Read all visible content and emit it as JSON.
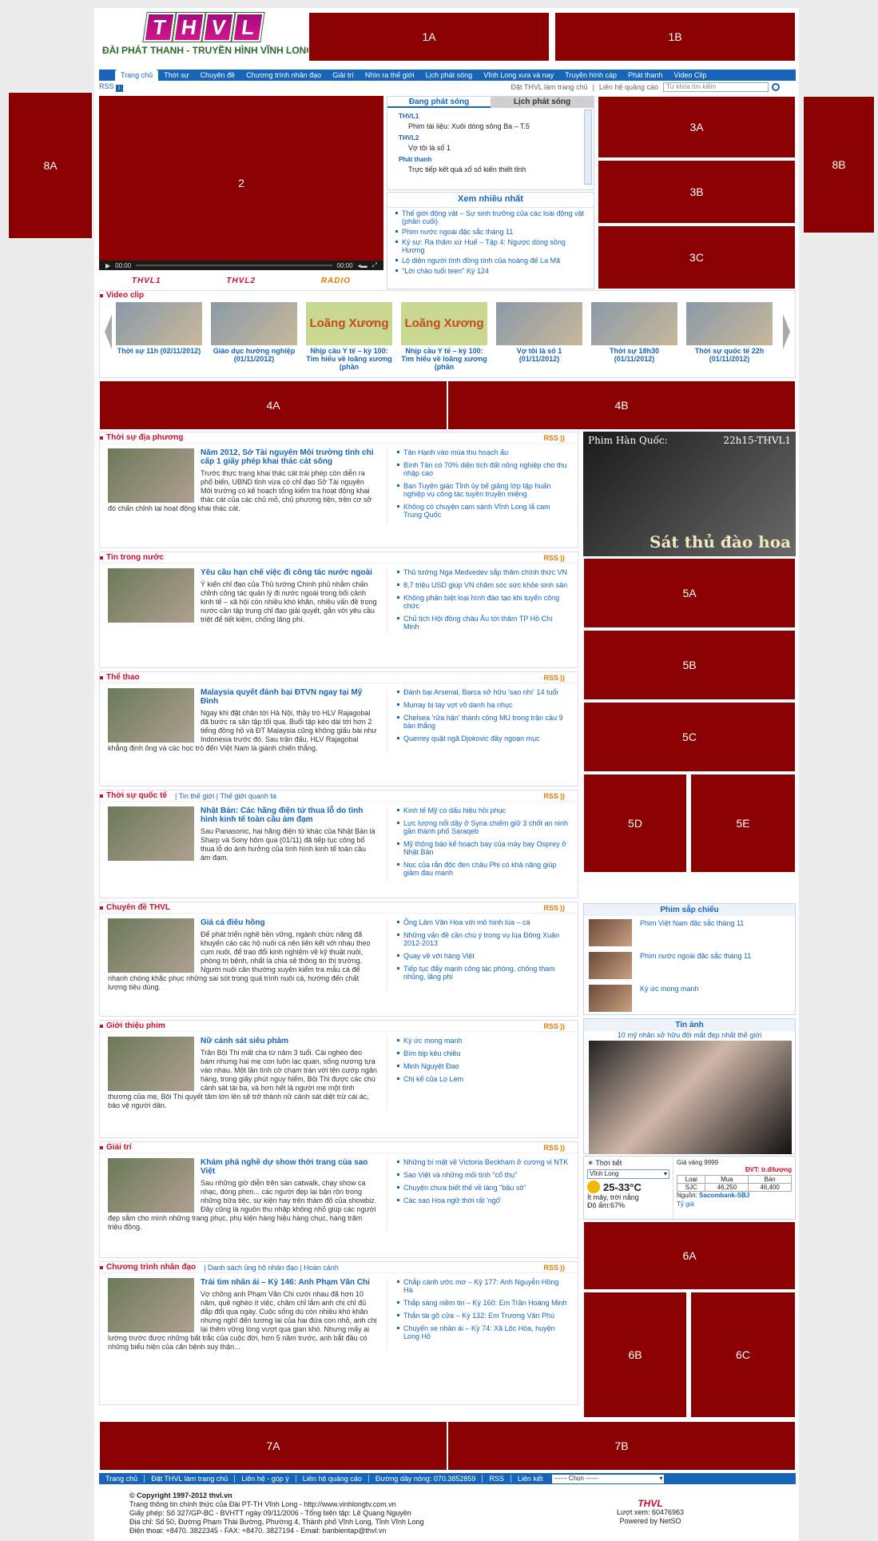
{
  "ads": {
    "a1A": "1A",
    "a1B": "1B",
    "a2": "2",
    "a3A": "3A",
    "a3B": "3B",
    "a3C": "3C",
    "a4A": "4A",
    "a4B": "4B",
    "a5A": "5A",
    "a5B": "5B",
    "a5C": "5C",
    "a5D": "5D",
    "a5E": "5E",
    "a6A": "6A",
    "a6B": "6B",
    "a6C": "6C",
    "a7A": "7A",
    "a7B": "7B",
    "a8A": "8A",
    "a8B": "8B"
  },
  "header": {
    "logo_letters": [
      "T",
      "H",
      "V",
      "L"
    ],
    "station_name": "ĐÀI PHÁT THANH - TRUYỀN HÌNH VĨNH LONG"
  },
  "nav": [
    "Trang chủ",
    "Thời sự",
    "Chuyên đề",
    "Chương trình nhân đạo",
    "Giải trí",
    "Nhìn ra thế giới",
    "Lịch phát sóng",
    "Vĩnh Long xưa và nay",
    "Truyền hình cáp",
    "Phát thanh",
    "Video Clip"
  ],
  "subbar": {
    "rss": "RSS",
    "link1": "Đặt THVL làm trang chủ",
    "link2": "Liên hệ quảng cáo",
    "search_placeholder": "Từ khóa tìm kiếm"
  },
  "player": {
    "time_left": "00:00",
    "time_right": "00:00"
  },
  "channels": [
    "THVL1",
    "THVL2",
    "RADIO"
  ],
  "schedule": {
    "tab_active": "Đang phát sóng",
    "tab_other": "Lịch phát sóng",
    "items": [
      {
        "channel": "THVL1",
        "program": "Phim tài liệu: Xuôi dòng sông Ba – T.5"
      },
      {
        "channel": "THVL2",
        "program": "Vợ tôi là số 1"
      },
      {
        "channel": "Phát thanh",
        "program": "Trực tiếp kết quả xổ số kiến thiết tỉnh"
      }
    ]
  },
  "most_viewed": {
    "title": "Xem nhiều nhất",
    "items": [
      "Thế giới động vật – Sự sinh trưởng của các loài động vật (phần cuối)",
      "Phim nước ngoài đặc sắc tháng 11",
      "Ký sự: Ra thăm xứ Huế – Tập 4: Ngược dòng sông Hương",
      "Lộ diện người tình đồng tính của hoàng đế La Mã",
      "\"Lời chào tuổi teen\" Kỳ 124"
    ]
  },
  "video": {
    "title": "Video clip",
    "items": [
      {
        "caption": "Thời sự 11h (02/11/2012)",
        "thumb": ""
      },
      {
        "caption": "Giáo dục hướng nghiệp (01/11/2012)",
        "thumb": ""
      },
      {
        "caption": "Nhịp cầu Y tế – kỳ 100: Tìm hiểu về loãng xương (phần",
        "thumb": "Loãng Xương"
      },
      {
        "caption": "Nhịp cầu Y tế – kỳ 100: Tìm hiểu về loãng xương (phần",
        "thumb": "Loãng Xương"
      },
      {
        "caption": "Vợ tôi là số 1 (01/11/2012)",
        "thumb": ""
      },
      {
        "caption": "Thời sự 18h30 (01/11/2012)",
        "thumb": ""
      },
      {
        "caption": "Thời sự quốc tế 22h (01/11/2012)",
        "thumb": ""
      }
    ]
  },
  "sections": [
    {
      "title": "Thời sự địa phương",
      "sub": "",
      "headline": "Năm 2012, Sở Tài nguyên Môi trường tỉnh chỉ cấp 1 giấy phép khai thác cát sông",
      "desc": "Trước thực trạng khai thác cát trái phép còn diễn ra phổ biến, UBND tỉnh vừa có chỉ đạo Sở Tài nguyên Môi trường có kế hoạch tổng kiểm tra hoạt động khai thác cát của các chủ mỏ, chủ phương tiện, trên cơ sở đó chấn chỉnh lại hoạt động khai thác cát.",
      "links": [
        "Tân Hạnh vào mùa thu hoạch ấu",
        "Bình Tân có 70% diện tích đất nông nghiệp cho thu nhập cao",
        "Ban Tuyên giáo Tỉnh ủy bế giảng lớp tập huấn nghiệp vụ công tác tuyên truyền miệng",
        "Không có chuyện cam sành Vĩnh Long lấ cam Trung Quốc"
      ]
    },
    {
      "title": "Tin trong nước",
      "sub": "",
      "headline": "Yêu cầu hạn chế việc đi công tác nước ngoài",
      "desc": "Ý kiến chỉ đạo của Thủ tướng Chính phủ nhằm chấn chỉnh công tác quản lý đi nước ngoài trong bối cảnh kinh tế – xã hội còn nhiều khó khăn, nhiều vấn đề trong nước cần tập trung chỉ đạo giải quyết, gắn với yêu cầu triệt để tiết kiệm, chống lãng phí.",
      "links": [
        "Thủ tướng Nga Medvedev sắp thăm chính thức VN",
        "8,7 triệu USD giúp VN chăm sóc sức khỏe sinh sản",
        "Không phân biệt loại hình đào tạo khi tuyển công chức",
        "Chủ tịch Hội đồng châu Âu tới thăm TP Hồ Chí Minh"
      ]
    },
    {
      "title": "Thể thao",
      "sub": "",
      "headline": "Malaysia quyết đánh bại ĐTVN ngay tại Mỹ Đình",
      "desc": "Ngay khi đặt chân tới Hà Nội, thầy trò HLV Rajagobal đã bước ra sân tập tối qua. Buổi tập kéo dài tới hơn 2 tiếng đồng hồ và ĐT Malaysia cũng không giấu bài như Indonesia trước đó. Sau trận đấu, HLV Rajagobal khẳng định ông và các học trò đến Việt Nam là giành chiến thắng.",
      "links": [
        "Đánh bại Arsenal, Barca sở hữu 'sao nhí' 14 tuổi",
        "Murray bị tay vợt vô danh hạ nhục",
        "Chelsea 'rửa hận' thành công MU trong trận cầu 9 bàn thắng",
        "Querrey quật ngã Djokovic đầy ngoạn mục"
      ]
    },
    {
      "title": "Thời sự quốc tế",
      "sub": "| Tin thế giới | Thế giới quanh ta",
      "headline": "Nhật Bản: Các hãng điện tử thua lỗ do tình hình kinh tế toàn cầu ảm đạm",
      "desc": "Sau Panasonic, hai hãng điện tử khác của Nhật Bản là Sharp và Sony hôm qua (01/11) đã tiếp tục công bố thua lỗ do ảnh hưởng của tình hình kinh tế toàn cầu ảm đạm.",
      "links": [
        "Kinh tế Mỹ có dấu hiệu hồi phục",
        "Lực lượng nổi dậy ở Syria chiếm giữ 3 chốt an ninh gần thành phố Saraqeb",
        "Mỹ thông báo kế hoạch bay của máy bay Osprey ở Nhật Bản",
        "Nọc của rắn độc đen châu Phi có khả năng giúp giảm đau mạnh"
      ]
    },
    {
      "title": "Chuyên đề THVL",
      "sub": "",
      "headline": "Giá cá điêu hồng",
      "desc": "Để phát triển nghề bền vững, ngành chức năng đã khuyến cáo các hộ nuôi cá nên liên kết với nhau theo cụm nuôi, để trao đổi kinh nghiệm về kỹ thuật nuôi, phòng trị bệnh, nhất là chia sẻ thông tin thị trường. Người nuôi cần thường xuyên kiểm tra mẫu cá để nhanh chóng khắc phục những sai sót trong quá trình nuôi cá, hướng đến chất lượng tiêu dùng.",
      "links": [
        "Ông Lâm Văn Hoa với mô hình lúa – cá",
        "Những vấn đề cần chú ý trong vụ lúa Đông Xuân 2012-2013",
        "Quay về với hàng Việt",
        "Tiếp tục đẩy mạnh công tác phòng, chống tham nhũng, lãng phí"
      ]
    },
    {
      "title": "Giới thiệu phim",
      "sub": "",
      "headline": "Nữ cảnh sát siêu phàm",
      "desc": "Trần Bội Thi mất cha từ năm 3 tuổi. Cái nghèo đeo bám nhưng hai mẹ con luôn lạc quan, sống nương tựa vào nhau. Một lần tình cờ chạm trán với tên cướp ngân hàng, trong giây phút nguy hiểm, Bội Thi được các chú cảnh sát tài ba, và hơn hết là người mẹ một tình thương của mẹ, Bội Thi quyết tâm lớn lên sẽ trở thành nữ cảnh sát diệt trừ cái ác, bảo vệ người dân.",
      "links": [
        "Ký ức mong manh",
        "Bím bịp kêu chiều",
        "Minh Nguyệt Đao",
        "Chị kế của Lọ Lem"
      ]
    },
    {
      "title": "Giải trí",
      "sub": "",
      "headline": "Khám phá nghề dự show thời trang của sao Việt",
      "desc": "Sau những giờ diễn trên sàn catwalk, chạy show ca nhạc, đóng phim... các người đẹp lại bận rộn trong những bữa tiệc, sự kiện hay trên thảm đỏ của showbiz. Đây cũng là nguồn thu nhập không nhỏ giúp các người đẹp sắm cho mình những trang phục, phụ kiện hàng hiệu hàng chục, hàng trăm triệu đồng.",
      "links": [
        "Những bí mật về Victoria Beckham ở cương vị NTK",
        "Sao Việt và những mối tình \"cổ thụ\"",
        "Chuyện chưa biết thế về làng \"bầu sô\"",
        "Các sao Hoa ngữ thời rất 'ngố'"
      ]
    },
    {
      "title": "Chương trình nhân đạo",
      "sub": "| Danh sách ủng hộ nhân đạo | Hoàn cảnh",
      "headline": "Trái tim nhân ái – Kỳ 146: Anh Phạm Văn Chi",
      "desc": "Vợ chồng anh Phạm Văn Chi cưới nhau đã hơn 10 năm, quê nghèo ít việc, chăm chỉ lắm anh chị chỉ đủ đắp đổi qua ngày. Cuộc sống dù còn nhiều khó khăn nhưng nghĩ đến tương lai của hai đứa con nhỏ, anh chị lại thêm vững lòng vượt qua gian khó. Nhưng mấy ai lường trước được những bất trắc của cuộc đời, hơn 5 năm trước, anh bắt đầu có những biểu hiện của căn bệnh suy thận...",
      "links": [
        "Chắp cánh ước mơ – Kỳ 177: Anh Nguyễn Hồng Hà",
        "Thắp sáng niềm tin – Kỳ 160: Em Trần Hoàng Minh",
        "Thắn tài gõ cửa – Kỳ 132: Em Trương Văn Phú",
        "Chuyến xe nhân ái – Kỳ 74: Xã Lộc Hòa, huyện Long Hồ"
      ]
    }
  ],
  "side_banner": {
    "left": "Phim Hàn Quốc:",
    "right": "22h15-THVL1",
    "title": "Sát thủ đào hoa"
  },
  "upcoming": {
    "title": "Phim sắp chiếu",
    "items": [
      "Phim Việt Nam đặc sắc tháng 11",
      "Phim nước ngoài đặc sắc tháng 11",
      "Ký ức mong manh"
    ]
  },
  "photo": {
    "title": "Tin ảnh",
    "caption": "10 mỹ nhân sở hữu đôi mắt đẹp nhất thế giới"
  },
  "weather": {
    "label": "Thời tiết",
    "location": "Vĩnh Long",
    "temp": "25-33°C",
    "cond": "Ít mây, trời nắng",
    "humidity": "Độ ẩm:67%"
  },
  "gold": {
    "title": "Giá vàng 9999",
    "unit": "ĐVT: tr.đ/lượng",
    "head": [
      "Loại",
      "Mua",
      "Bán"
    ],
    "row": [
      "SJC",
      "46,250",
      "46,400"
    ],
    "source_label": "Nguồn:",
    "source": "Sacombank-SBJ",
    "rate": "Tỷ giá"
  },
  "footer_nav": [
    "Trang chủ",
    "Đặt THVL làm trang chủ",
    "Liên hệ - góp ý",
    "Liên hệ quảng cáo",
    "Đường dây nóng: 070.3852859",
    "RSS",
    "Liên kết"
  ],
  "footer_select": "------ Chọn ------",
  "footer": {
    "copyright": "© Copyright 1997-2012 thvl.vn",
    "l1": "Trang thông tin chính thức của Đài PT-TH Vĩnh Long - http://www.vinhlongtv.com.vn",
    "l2": "Giấy phép: Số 327/GP-BC - BVHTT ngày 09/11/2006 - Tổng biên tập: Lê Quang Nguyên",
    "l3": "Địa chỉ: Số 50, Đường Phạm Thái Bường, Phường 4, Thành phố Vĩnh Long, Tỉnh Vĩnh Long",
    "l4": "Điện thoại: +8470. 3822345 - FAX: +8470. 3827194 - Email: banbientap@thvl.vn",
    "logo": "THVL",
    "visits": "Lượt xem: 60476963",
    "powered": "Powered by NetSO"
  }
}
